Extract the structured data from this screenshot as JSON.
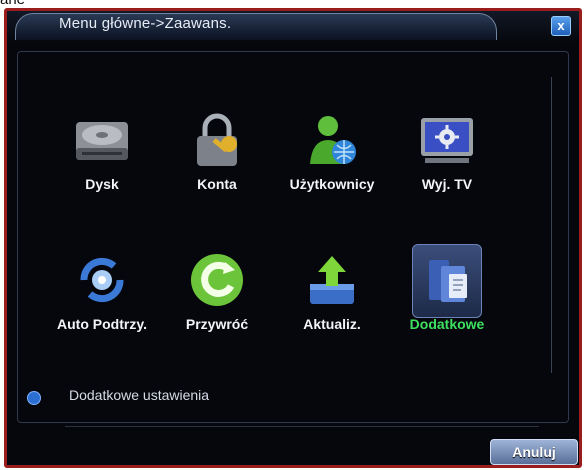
{
  "page_crop_text": "ane",
  "window": {
    "title": "Menu główne->Zaawans.",
    "close_glyph": "x"
  },
  "items": [
    {
      "label": "Dysk",
      "icon": "hard-disk-icon"
    },
    {
      "label": "Konta",
      "icon": "lock-key-icon"
    },
    {
      "label": "Użytkownicy",
      "icon": "users-globe-icon"
    },
    {
      "label": "Wyj. TV",
      "icon": "tv-gear-icon"
    },
    {
      "label": "Auto Podtrzy.",
      "icon": "auto-maintain-icon"
    },
    {
      "label": "Przywróć",
      "icon": "restore-icon"
    },
    {
      "label": "Aktualiz.",
      "icon": "upgrade-icon"
    },
    {
      "label": "Dodatkowe",
      "icon": "additional-settings-icon",
      "active": true
    }
  ],
  "info": {
    "text": "Dodatkowe ustawienia"
  },
  "buttons": {
    "cancel": "Anuluj"
  },
  "colors": {
    "active_label": "#3ee060",
    "frame": "#9a1d1d"
  }
}
